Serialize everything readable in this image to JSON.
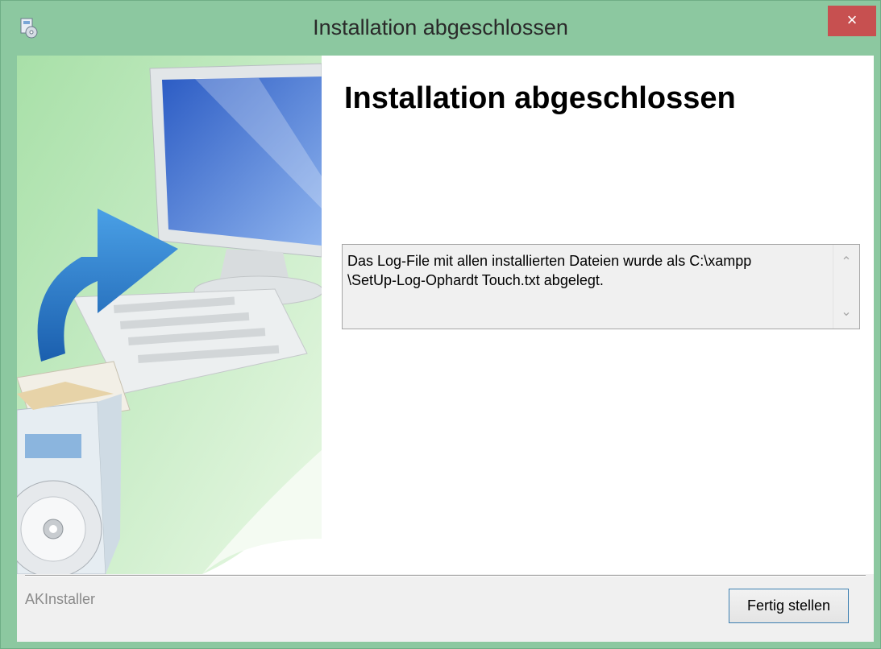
{
  "window": {
    "title": "Installation abgeschlossen",
    "close_glyph": "×",
    "icon": "installer-app-icon"
  },
  "main": {
    "heading": "Installation abgeschlossen",
    "log_text": "Das Log-File mit allen installierten Dateien wurde als C:\\xampp\n\\SetUp-Log-Ophardt Touch.txt abgelegt.",
    "scroll_up_glyph": "⌃",
    "scroll_down_glyph": "⌄"
  },
  "footer": {
    "brand": "AKInstaller",
    "finish_label": "Fertig stellen"
  },
  "colors": {
    "titlebar": "#8cc8a0",
    "close": "#c75050",
    "button_border": "#3c7fb1"
  }
}
